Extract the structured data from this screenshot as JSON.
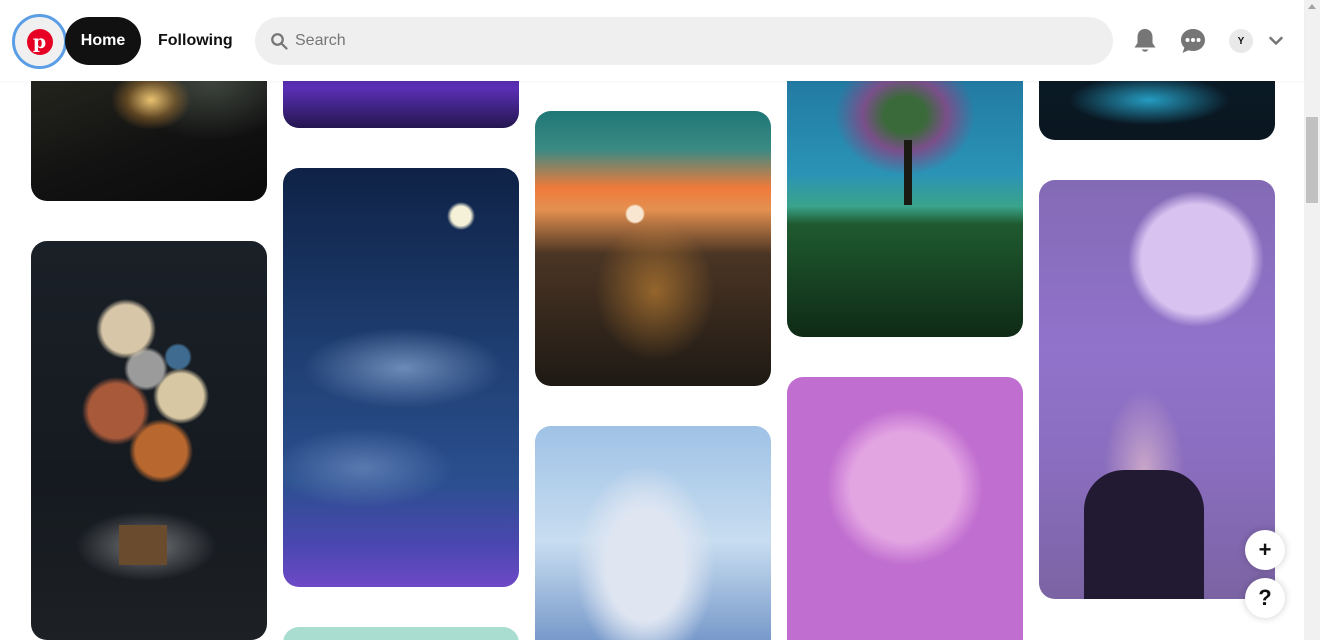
{
  "header": {
    "logo_letter": "p",
    "nav": {
      "home_label": "Home",
      "following_label": "Following"
    },
    "search": {
      "placeholder": "Search",
      "value": ""
    },
    "avatar_initial": "Y",
    "icons": [
      "pinterest-logo",
      "bell-icon",
      "message-icon",
      "chevron-down-icon"
    ]
  },
  "pins": [
    {
      "id": "pin-1",
      "subject": "golden light in dark space"
    },
    {
      "id": "pin-2",
      "subject": "purple night"
    },
    {
      "id": "pin-3",
      "subject": "glowing butterfly jar at sunset"
    },
    {
      "id": "pin-4",
      "subject": "colorful tree on green field"
    },
    {
      "id": "pin-5",
      "subject": "blue glowing scene with wolves"
    },
    {
      "id": "pin-6",
      "subject": "planet balloons lifting house"
    },
    {
      "id": "pin-7",
      "subject": "moon over blue cloudy sky"
    },
    {
      "id": "pin-8",
      "subject": "teal pin (partial)"
    },
    {
      "id": "pin-9",
      "subject": "anime girl with white hair"
    },
    {
      "id": "pin-10",
      "subject": "pink moon over clouds and sea"
    },
    {
      "id": "pin-11",
      "subject": "hand holding fairy-light jar under purple moon"
    }
  ],
  "floating": {
    "add_label": "+",
    "help_label": "?"
  },
  "colors": {
    "brand": "#e60023",
    "home_bg": "#111111",
    "search_bg": "#efefef",
    "focus_ring": "#5b9ee6"
  }
}
